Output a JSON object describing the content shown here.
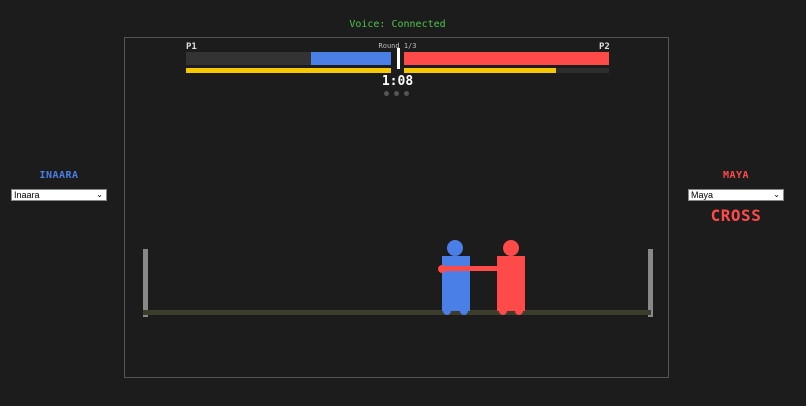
{
  "voice_status": "Voice: Connected",
  "left_panel": {
    "player_name": "INAARA",
    "select_value": "Inaara",
    "name_color": "#4a7fe8"
  },
  "right_panel": {
    "player_name": "MAYA",
    "select_value": "Maya",
    "action": "CROSS",
    "name_color": "#ff4a4a"
  },
  "hud": {
    "p1_label": "P1",
    "p2_label": "P2",
    "round": "Round 1/3",
    "timer": "1:08",
    "p1_health": 0.39,
    "p2_health": 1.0,
    "p1_stamina": 1.0,
    "p2_stamina": 0.74,
    "round_dots": 3,
    "p1_color": "#4a7fe8",
    "p2_color": "#ff4a4a",
    "stamina_color": "#f5c800"
  },
  "fighters": {
    "p1": {
      "name": "Inaara",
      "color": "#4a7fe8"
    },
    "p2": {
      "name": "Maya",
      "color": "#ff4a4a",
      "action": "CROSS"
    }
  }
}
